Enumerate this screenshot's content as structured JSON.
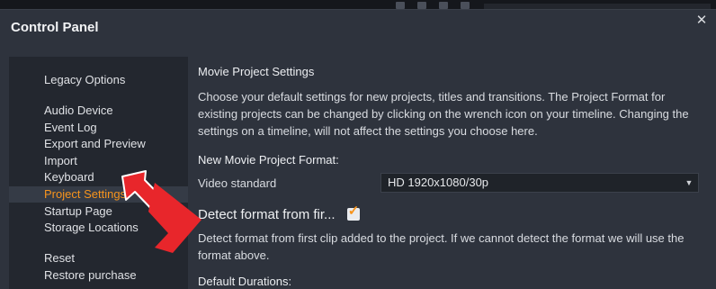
{
  "window": {
    "title": "Control Panel",
    "close_icon": "close-icon"
  },
  "sidebar": {
    "items": [
      {
        "label": "Legacy Options",
        "active": false
      },
      {
        "label": "Audio Device",
        "active": false
      },
      {
        "label": "Event Log",
        "active": false
      },
      {
        "label": "Export and Preview",
        "active": false
      },
      {
        "label": "Import",
        "active": false
      },
      {
        "label": "Keyboard",
        "active": false
      },
      {
        "label": "Project Settings",
        "active": true
      },
      {
        "label": "Startup Page",
        "active": false
      },
      {
        "label": "Storage Locations",
        "active": false
      },
      {
        "label": "Reset",
        "active": false
      },
      {
        "label": "Restore purchase",
        "active": false
      }
    ]
  },
  "main": {
    "heading": "Movie Project Settings",
    "description": "Choose your default settings for new projects, titles and transitions. The Project Format for existing projects can be changed by clicking on the wrench icon on your timeline. Changing the settings on a timeline, will not affect the settings you choose here.",
    "format_heading": "New Movie Project Format:",
    "video_standard": {
      "label": "Video standard",
      "value": "HD 1920x1080/30p"
    },
    "detect_format": {
      "label": "Detect format from fir...",
      "checked": true,
      "description": "Detect format from first clip added to the project. If we cannot detect the format we will use the format above."
    },
    "durations_heading": "Default Durations:"
  },
  "colors": {
    "accent": "#f7941d",
    "annotation_arrow": "#e8262b",
    "window_bg": "#2e333d",
    "sidebar_bg": "#23272f"
  }
}
